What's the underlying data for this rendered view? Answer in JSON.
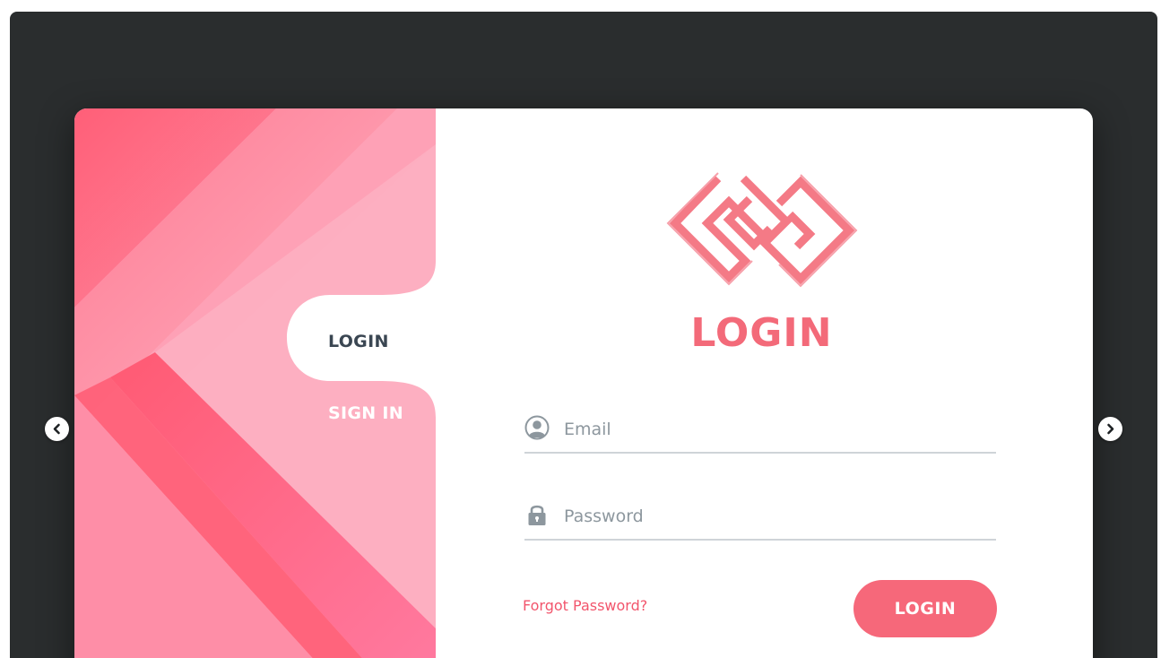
{
  "colors": {
    "backdrop": "#2a2d2e",
    "accent": "#f6687a",
    "title": "#f36a79",
    "link": "#f2556c",
    "active_tab_text": "#3a4652",
    "panel_pink": "#fda5ba",
    "panel_deep": "#f86a82"
  },
  "tabs": {
    "login_label": "LOGIN",
    "signin_label": "SIGN IN",
    "active": "login"
  },
  "form": {
    "title": "LOGIN",
    "email": {
      "placeholder": "Email",
      "value": "",
      "icon": "user-icon"
    },
    "password": {
      "placeholder": "Password",
      "value": "",
      "icon": "lock-icon"
    },
    "forgot_label": "Forgot Password?",
    "submit_label": "LOGIN"
  },
  "carousel": {
    "prev_icon": "chevron-left-icon",
    "next_icon": "chevron-right-icon"
  }
}
